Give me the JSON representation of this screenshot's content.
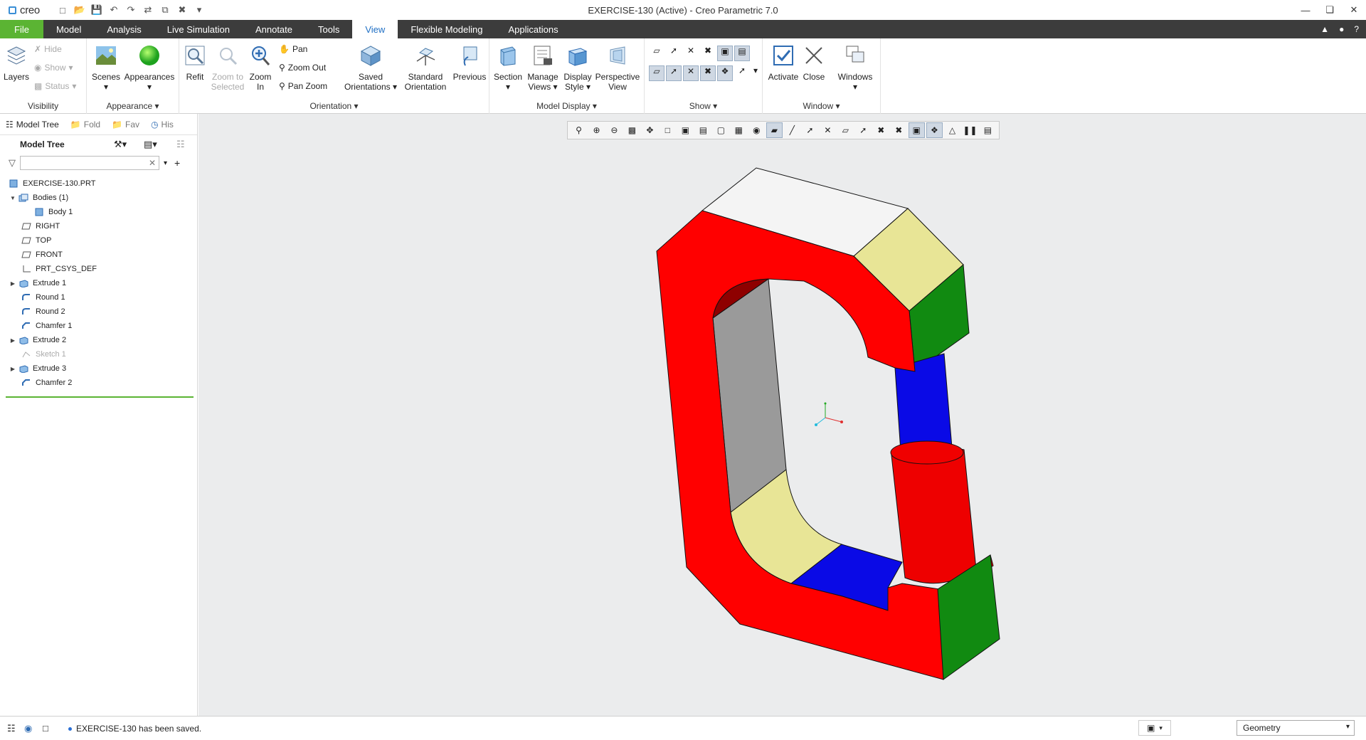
{
  "app": {
    "logo": "creo",
    "window_title": "EXERCISE-130 (Active) - Creo Parametric 7.0"
  },
  "tabs": [
    "File",
    "Model",
    "Analysis",
    "Live Simulation",
    "Annotate",
    "Tools",
    "View",
    "Flexible Modeling",
    "Applications"
  ],
  "ribbon": {
    "visibility": {
      "title": "Visibility",
      "layers": "Layers",
      "hide": "Hide",
      "show": "Show",
      "status": "Status"
    },
    "appearance": {
      "title": "Appearance",
      "scenes": "Scenes",
      "appearances": "Appearances"
    },
    "orientation": {
      "title": "Orientation",
      "refit": "Refit",
      "zoom_to_selected_1": "Zoom to",
      "zoom_to_selected_2": "Selected",
      "zoom_in_1": "Zoom",
      "zoom_in_2": "In",
      "pan": "Pan",
      "zoom_out": "Zoom Out",
      "pan_zoom": "Pan Zoom",
      "saved_1": "Saved",
      "saved_2": "Orientations",
      "standard_1": "Standard",
      "standard_2": "Orientation",
      "previous": "Previous"
    },
    "model_display": {
      "title": "Model Display",
      "section": "Section",
      "manage_1": "Manage",
      "manage_2": "Views",
      "display_1": "Display",
      "display_2": "Style",
      "perspective_1": "Perspective",
      "perspective_2": "View"
    },
    "show": {
      "title": "Show"
    },
    "window": {
      "title": "Window",
      "activate": "Activate",
      "close": "Close",
      "windows": "Windows"
    }
  },
  "nav_tabs": {
    "model_tree": "Model Tree",
    "folder": "Fold",
    "favorites": "Fav",
    "history": "His"
  },
  "tree": {
    "header": "Model Tree",
    "filter_placeholder": "",
    "items": [
      {
        "label": "EXERCISE-130.PRT"
      },
      {
        "label": "Bodies (1)"
      },
      {
        "label": "Body 1"
      },
      {
        "label": "RIGHT"
      },
      {
        "label": "TOP"
      },
      {
        "label": "FRONT"
      },
      {
        "label": "PRT_CSYS_DEF"
      },
      {
        "label": "Extrude 1"
      },
      {
        "label": "Round 1"
      },
      {
        "label": "Round 2"
      },
      {
        "label": "Chamfer 1"
      },
      {
        "label": "Extrude 2"
      },
      {
        "label": "Sketch 1"
      },
      {
        "label": "Extrude 3"
      },
      {
        "label": "Chamfer 2"
      }
    ]
  },
  "status": {
    "message": "EXERCISE-130 has been saved.",
    "filter": "Geometry"
  },
  "colors": {
    "file_tab": "#5bb433",
    "tab_bar": "#3c3c3c",
    "accent": "#1f6fc4",
    "body_red": "#ff0000",
    "face_yellow": "#e8e596",
    "face_green": "#118a11",
    "face_blue": "#0a0ae6",
    "face_grey": "#9a9a9a"
  }
}
